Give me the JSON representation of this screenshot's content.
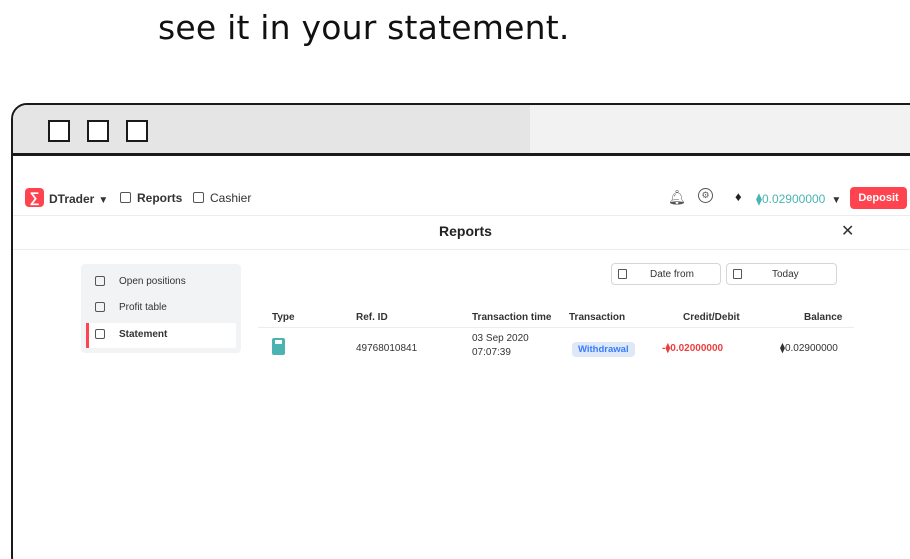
{
  "caption": "see it in your statement.",
  "app": {
    "brand": "DTrader",
    "nav": [
      {
        "label": "Reports"
      },
      {
        "label": "Cashier"
      }
    ],
    "balance": "0.02900000",
    "currency_symbol": "⧫",
    "deposit_label": "Deposit",
    "accent_color": "#ff444f",
    "balance_color": "#4bb4b3"
  },
  "reports": {
    "title": "Reports",
    "close_label": "✕",
    "menu": [
      {
        "label": "Open positions",
        "icon": "open-positions-icon",
        "active": false
      },
      {
        "label": "Profit table",
        "icon": "profit-table-icon",
        "active": false
      },
      {
        "label": "Statement",
        "icon": "statement-icon",
        "active": true
      }
    ],
    "filters": {
      "date_from": "Date from",
      "date_to": "Today"
    },
    "table": {
      "headers": [
        "Type",
        "Ref. ID",
        "Transaction time",
        "Transaction",
        "Credit/Debit",
        "Balance"
      ],
      "rows": [
        {
          "type_icon": "withdrawal-icon",
          "ref_id": "49768010841",
          "time_date": "03 Sep 2020",
          "time_clock": "07:07:39",
          "transaction": "Withdrawal",
          "credit_debit": "-⧫0.02000000",
          "balance": "⧫0.02900000"
        }
      ]
    }
  }
}
